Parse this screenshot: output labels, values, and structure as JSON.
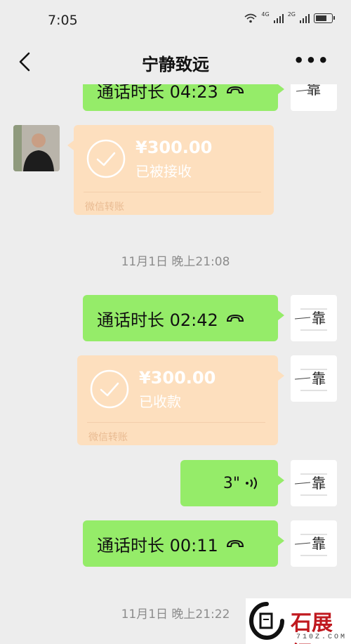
{
  "status_bar": {
    "time": "7:05",
    "net1": "4G",
    "net2": "2G"
  },
  "header": {
    "title": "宁静致远",
    "back_icon": "back-arrow-icon",
    "more_icon": "more-dots-icon"
  },
  "messages": {
    "top_partial_call": {
      "text": "通话时长 04:23"
    },
    "transfer1": {
      "amount": "¥300.00",
      "status": "已被接收",
      "label": "微信转账"
    },
    "timestamp1": "11月1日 晚上21:08",
    "call2": {
      "text": "通话时长 02:42"
    },
    "transfer2": {
      "amount": "¥300.00",
      "status": "已收款",
      "label": "微信转账"
    },
    "voice": {
      "duration": "3\""
    },
    "call3": {
      "text": "通话时长 00:11"
    },
    "timestamp2": "11月1日 晚上21:22"
  },
  "watermark": {
    "name": "石展網",
    "site": "710Z.COM"
  },
  "colors": {
    "bubble_green": "#95ec69",
    "transfer_orange": "#fddfbe",
    "background": "#ededed",
    "watermark_red": "#c0191f"
  }
}
